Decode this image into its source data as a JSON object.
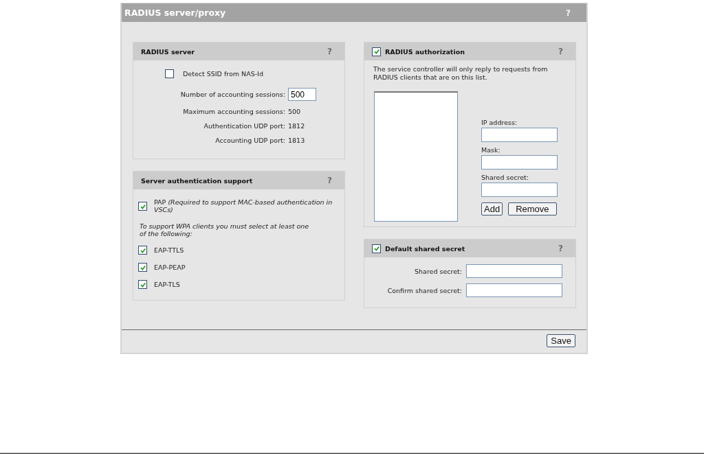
{
  "window": {
    "title": "RADIUS server/proxy",
    "help": "?"
  },
  "radius_server": {
    "title": "RADIUS server",
    "help": "?",
    "detect_ssid": {
      "label": "Detect SSID from NAS-Id",
      "checked": false
    },
    "rows": [
      {
        "kind": "input",
        "label": "Number of accounting sessions:",
        "value": "500"
      },
      {
        "kind": "text",
        "label": "Maximum accounting sessions:",
        "value": "500"
      },
      {
        "kind": "text",
        "label": "Authentication UDP port:",
        "value": "1812"
      },
      {
        "kind": "text",
        "label": "Accounting UDP port:",
        "value": "1813"
      }
    ]
  },
  "server_auth": {
    "title": "Server authentication support",
    "help": "?",
    "pap": {
      "label": "PAP *(Required to support MAC-based authentication in VSCs)*",
      "checked": true
    },
    "note": "To support WPA clients you must select at least one of the following:",
    "options": [
      {
        "label": "EAP-TTLS",
        "checked": true
      },
      {
        "label": "EAP-PEAP",
        "checked": true
      },
      {
        "label": "EAP-TLS",
        "checked": true
      }
    ]
  },
  "radius_authorization": {
    "title": "RADIUS authorization",
    "checked": true,
    "help": "?",
    "description": "The service controller will only reply to requests from RADIUS clients that are on this list.",
    "fields": [
      {
        "label": "IP address:"
      },
      {
        "label": "Mask:"
      },
      {
        "label": "Shared secret:"
      }
    ],
    "buttons": [
      "Add",
      "Remove"
    ]
  },
  "default_shared_secret": {
    "title": "Default shared secret",
    "checked": true,
    "help": "?",
    "fields": [
      {
        "label": "Shared secret:"
      },
      {
        "label": "Confirm shared secret:"
      }
    ]
  },
  "footer": {
    "buttons": [
      "Save"
    ]
  }
}
